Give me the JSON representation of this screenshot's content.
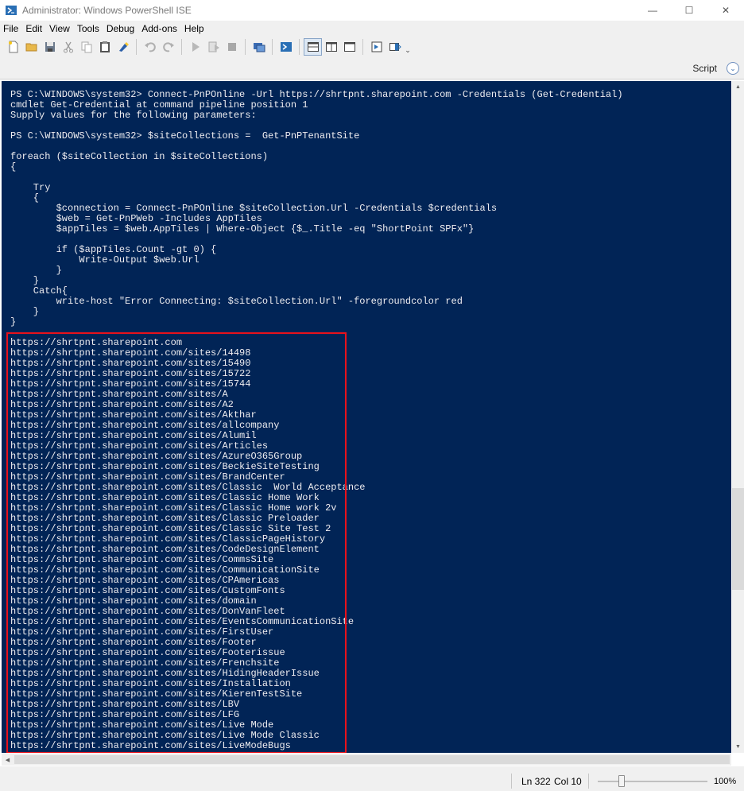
{
  "window": {
    "title": "Administrator: Windows PowerShell ISE",
    "minimize_glyph": "—",
    "maximize_glyph": "☐",
    "close_glyph": "✕"
  },
  "menu": [
    "File",
    "Edit",
    "View",
    "Tools",
    "Debug",
    "Add-ons",
    "Help"
  ],
  "toolbar": {
    "icons": [
      "new-file-icon",
      "open-folder-icon",
      "save-icon",
      "cut-icon",
      "copy-icon",
      "paste-icon",
      "clear-console-icon",
      "undo-icon",
      "redo-icon",
      "run-script-icon",
      "run-selection-icon",
      "stop-icon",
      "new-remote-tab-icon",
      "start-powershell-icon",
      "show-script-pane-top-icon",
      "show-script-pane-right-icon",
      "show-script-pane-maximized-icon",
      "show-commands-icon",
      "show-commands-addon-icon",
      "toolbar-overflow-icon"
    ]
  },
  "script_bar": {
    "label": "Script",
    "toggle_glyph": "⌄"
  },
  "console": {
    "lines": [
      "PS C:\\WINDOWS\\system32> Connect-PnPOnline -Url https://shrtpnt.sharepoint.com -Credentials (Get-Credential)",
      "cmdlet Get-Credential at command pipeline position 1",
      "Supply values for the following parameters:",
      "",
      "PS C:\\WINDOWS\\system32> $siteCollections =  Get-PnPTenantSite",
      "",
      "foreach ($siteCollection in $siteCollections)",
      "{",
      "",
      "    Try",
      "    {",
      "        $connection = Connect-PnPOnline $siteCollection.Url -Credentials $credentials",
      "        $web = Get-PnPWeb -Includes AppTiles",
      "        $appTiles = $web.AppTiles | Where-Object {$_.Title -eq \"ShortPoint SPFx\"}",
      "",
      "        if ($appTiles.Count -gt 0) {",
      "            Write-Output $web.Url",
      "        }",
      "    }",
      "    Catch{",
      "        write-host \"Error Connecting: $siteCollection.Url\" -foregroundcolor red",
      "    }",
      "}",
      "",
      "https://shrtpnt.sharepoint.com",
      "https://shrtpnt.sharepoint.com/sites/14498",
      "https://shrtpnt.sharepoint.com/sites/15490",
      "https://shrtpnt.sharepoint.com/sites/15722",
      "https://shrtpnt.sharepoint.com/sites/15744",
      "https://shrtpnt.sharepoint.com/sites/A",
      "https://shrtpnt.sharepoint.com/sites/A2",
      "https://shrtpnt.sharepoint.com/sites/Akthar",
      "https://shrtpnt.sharepoint.com/sites/allcompany",
      "https://shrtpnt.sharepoint.com/sites/Alumil",
      "https://shrtpnt.sharepoint.com/sites/Articles",
      "https://shrtpnt.sharepoint.com/sites/AzureO365Group",
      "https://shrtpnt.sharepoint.com/sites/BeckieSiteTesting",
      "https://shrtpnt.sharepoint.com/sites/BrandCenter",
      "https://shrtpnt.sharepoint.com/sites/Classic  World Acceptance",
      "https://shrtpnt.sharepoint.com/sites/Classic Home Work",
      "https://shrtpnt.sharepoint.com/sites/Classic Home work 2v",
      "https://shrtpnt.sharepoint.com/sites/Classic Preloader",
      "https://shrtpnt.sharepoint.com/sites/Classic Site Test 2",
      "https://shrtpnt.sharepoint.com/sites/ClassicPageHistory",
      "https://shrtpnt.sharepoint.com/sites/CodeDesignElement",
      "https://shrtpnt.sharepoint.com/sites/CommsSite",
      "https://shrtpnt.sharepoint.com/sites/CommunicationSite",
      "https://shrtpnt.sharepoint.com/sites/CPAmericas",
      "https://shrtpnt.sharepoint.com/sites/CustomFonts",
      "https://shrtpnt.sharepoint.com/sites/domain",
      "https://shrtpnt.sharepoint.com/sites/DonVanFleet",
      "https://shrtpnt.sharepoint.com/sites/EventsCommunicationSite",
      "https://shrtpnt.sharepoint.com/sites/FirstUser",
      "https://shrtpnt.sharepoint.com/sites/Footer",
      "https://shrtpnt.sharepoint.com/sites/Footerissue",
      "https://shrtpnt.sharepoint.com/sites/Frenchsite",
      "https://shrtpnt.sharepoint.com/sites/HidingHeaderIssue",
      "https://shrtpnt.sharepoint.com/sites/Installation",
      "https://shrtpnt.sharepoint.com/sites/KierenTestSite",
      "https://shrtpnt.sharepoint.com/sites/LBV",
      "https://shrtpnt.sharepoint.com/sites/LFG",
      "https://shrtpnt.sharepoint.com/sites/Live Mode",
      "https://shrtpnt.sharepoint.com/sites/Live Mode Classic",
      "https://shrtpnt.sharepoint.com/sites/LiveModeBugs"
    ]
  },
  "colors": {
    "console_background": "#012456",
    "console_text": "#eeedf0",
    "highlight_border": "#e8121b"
  },
  "status": {
    "line": "Ln 322",
    "column": "Col 10",
    "zoom": "100%",
    "zoom_level_percent": 100
  }
}
